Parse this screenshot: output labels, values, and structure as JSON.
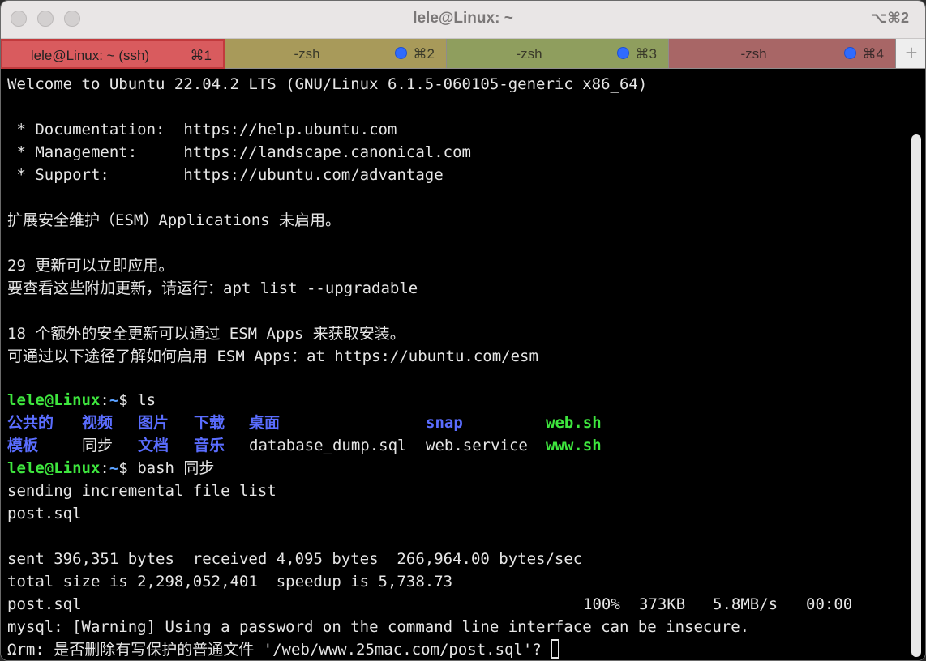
{
  "window": {
    "title": "lele@Linux: ~",
    "shortcut": "⌥⌘2"
  },
  "tabs": [
    {
      "label": "lele@Linux: ~ (ssh)",
      "key": "⌘1",
      "color": "#d95b5e",
      "active": true
    },
    {
      "label": "-zsh",
      "key": "⌘2",
      "color": "#a89a5a",
      "active": false
    },
    {
      "label": "-zsh",
      "key": "⌘3",
      "color": "#8f9e5e",
      "active": false
    },
    {
      "label": "-zsh",
      "key": "⌘4",
      "color": "#a86666",
      "active": false
    }
  ],
  "new_tab_label": "+",
  "terminal": {
    "welcome": "Welcome to Ubuntu 22.04.2 LTS (GNU/Linux 6.1.5-060105-generic x86_64)",
    "docs": " * Documentation:  https://help.ubuntu.com",
    "mgmt": " * Management:     https://landscape.canonical.com",
    "support": " * Support:        https://ubuntu.com/advantage",
    "esm": "扩展安全维护（ESM）Applications 未启用。",
    "updates1": "29 更新可以立即应用。",
    "updates2": "要查看这些附加更新，请运行：apt list --upgradable",
    "esm2": "18 个额外的安全更新可以通过 ESM Apps 来获取安装。",
    "esm3": "可通过以下途径了解如何启用 ESM Apps：at https://ubuntu.com/esm",
    "prompt_user": "lele@Linux",
    "prompt_sep": ":",
    "prompt_path": "~",
    "prompt_dollar": "$",
    "cmd1": " ls",
    "ls_row1": [
      {
        "text": "公共的",
        "kind": "dir"
      },
      {
        "text": "视频",
        "kind": "dir"
      },
      {
        "text": "图片",
        "kind": "dir"
      },
      {
        "text": "下载",
        "kind": "dir"
      },
      {
        "text": "桌面",
        "kind": "dir"
      },
      {
        "text": "snap",
        "kind": "dir"
      },
      {
        "text": "web.sh",
        "kind": "exec"
      }
    ],
    "ls_row2": [
      {
        "text": "模板",
        "kind": "dir"
      },
      {
        "text": "同步",
        "kind": "plain"
      },
      {
        "text": "文档",
        "kind": "dir"
      },
      {
        "text": "音乐",
        "kind": "dir"
      },
      {
        "text": "database_dump.sql",
        "kind": "plain"
      },
      {
        "text": "web.service",
        "kind": "plain"
      },
      {
        "text": "www.sh",
        "kind": "exec"
      }
    ],
    "cmd2": " bash 同步",
    "rsync1": "sending incremental file list",
    "rsync2": "post.sql",
    "sent": "sent 396,351 bytes  received 4,095 bytes  266,964.00 bytes/sec",
    "total": "total size is 2,298,052,401  speedup is 5,738.73",
    "progress_file": "post.sql",
    "progress_pct": "100%",
    "progress_size": "373KB",
    "progress_rate": "5.8MB/s",
    "progress_time": "00:00",
    "mysql_warn": "mysql: [Warning] Using a password on the command line interface can be insecure.",
    "rm_prompt": "Ωrm: 是否删除有写保护的普通文件 '/web/www.25mac.com/post.sql'? "
  }
}
